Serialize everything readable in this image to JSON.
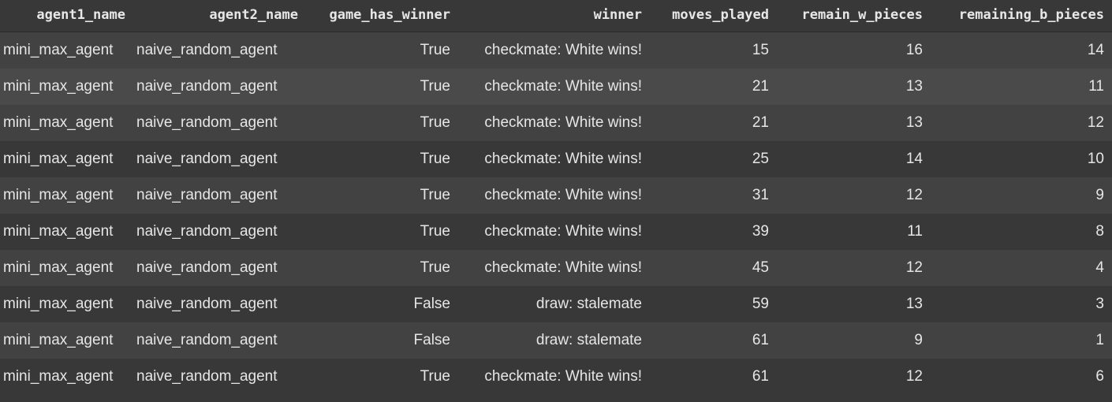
{
  "table": {
    "columns": [
      "agent1_name",
      "agent2_name",
      "game_has_winner",
      "winner",
      "moves_played",
      "remain_w_pieces",
      "remaining_b_pieces"
    ],
    "rows": [
      [
        "mini_max_agent",
        "naive_random_agent",
        "True",
        "checkmate: White wins!",
        "15",
        "16",
        "14"
      ],
      [
        "mini_max_agent",
        "naive_random_agent",
        "True",
        "checkmate: White wins!",
        "21",
        "13",
        "11"
      ],
      [
        "mini_max_agent",
        "naive_random_agent",
        "True",
        "checkmate: White wins!",
        "21",
        "13",
        "12"
      ],
      [
        "mini_max_agent",
        "naive_random_agent",
        "True",
        "checkmate: White wins!",
        "25",
        "14",
        "10"
      ],
      [
        "mini_max_agent",
        "naive_random_agent",
        "True",
        "checkmate: White wins!",
        "31",
        "12",
        "9"
      ],
      [
        "mini_max_agent",
        "naive_random_agent",
        "True",
        "checkmate: White wins!",
        "39",
        "11",
        "8"
      ],
      [
        "mini_max_agent",
        "naive_random_agent",
        "True",
        "checkmate: White wins!",
        "45",
        "12",
        "4"
      ],
      [
        "mini_max_agent",
        "naive_random_agent",
        "False",
        "draw: stalemate",
        "59",
        "13",
        "3"
      ],
      [
        "mini_max_agent",
        "naive_random_agent",
        "False",
        "draw: stalemate",
        "61",
        "9",
        "1"
      ],
      [
        "mini_max_agent",
        "naive_random_agent",
        "True",
        "checkmate: White wins!",
        "61",
        "12",
        "6"
      ]
    ]
  },
  "colors": {
    "background": "#383838",
    "row_alt": "#424242",
    "row_hover": "#4a4a4a",
    "text": "#e6e6e6"
  }
}
